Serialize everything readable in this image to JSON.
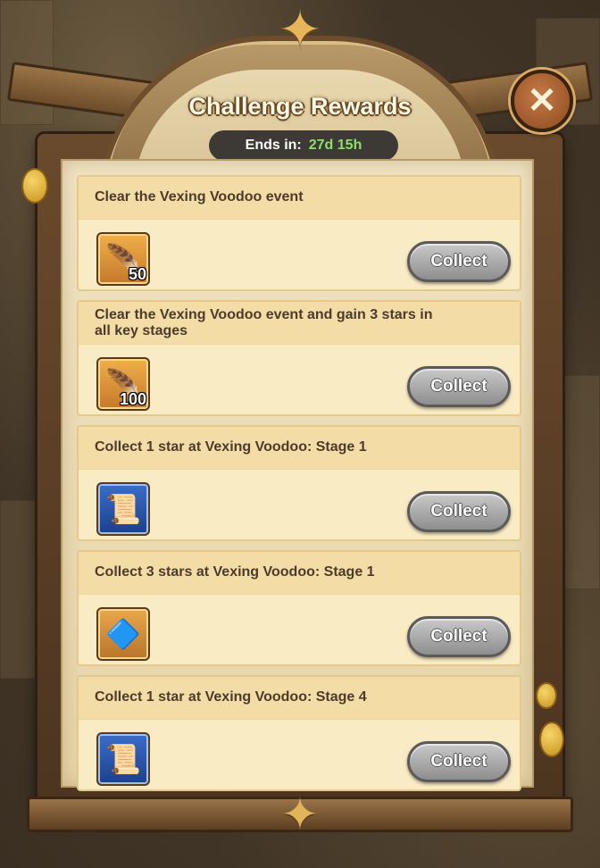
{
  "header": {
    "title": "Challenge Rewards",
    "timer_label": "Ends in:",
    "timer_value": "27d 15h",
    "close_icon": "close-icon"
  },
  "colors": {
    "timer_value": "#8be06a",
    "collect_button": "#a8a8a8",
    "parchment": "#f1e4c4"
  },
  "challenges": [
    {
      "description": "Clear the Vexing Voodoo event",
      "reward_icon": "summon-shard-icon",
      "reward_count": "50",
      "button_label": "Collect"
    },
    {
      "description": "Clear the Vexing Voodoo event and gain 3 stars in all key stages",
      "reward_icon": "summon-shard-icon",
      "reward_count": "100",
      "button_label": "Collect"
    },
    {
      "description": "Collect 1 star at Vexing Voodoo: Stage 1",
      "reward_icon": "scroll-icon",
      "reward_count": "",
      "button_label": "Collect"
    },
    {
      "description": "Collect 3 stars at Vexing Voodoo: Stage 1",
      "reward_icon": "emblem-card-icon",
      "reward_count": "",
      "button_label": "Collect"
    },
    {
      "description": "Collect 1 star at Vexing Voodoo: Stage 4",
      "reward_icon": "scroll-icon",
      "reward_count": "",
      "button_label": "Collect"
    }
  ]
}
